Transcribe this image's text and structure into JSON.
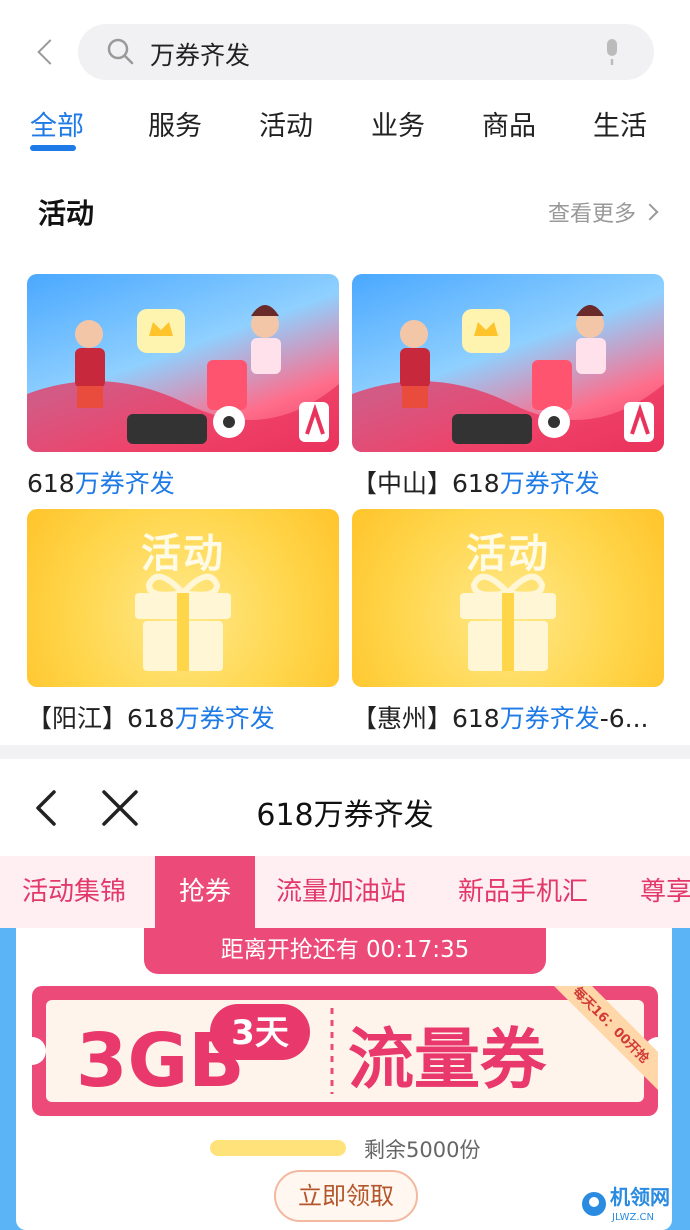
{
  "search": {
    "query": "万券齐发"
  },
  "tabs": [
    {
      "label": "全部",
      "active": true
    },
    {
      "label": "服务"
    },
    {
      "label": "活动"
    },
    {
      "label": "业务"
    },
    {
      "label": "商品"
    },
    {
      "label": "生活"
    }
  ],
  "section": {
    "title": "活动",
    "more": "查看更多"
  },
  "cards": [
    {
      "prefix": "618",
      "highlight": "万券齐发",
      "suffix": ""
    },
    {
      "prefix": "【中山】618",
      "highlight": "万券齐发",
      "suffix": ""
    },
    {
      "prefix": "【阳江】618",
      "highlight": "万券齐发",
      "suffix": "",
      "image_text": "活动"
    },
    {
      "prefix": "【惠州】618",
      "highlight": "万券齐发",
      "suffix": "-6...",
      "image_text": "活动"
    }
  ],
  "webview": {
    "title": "618万券齐发",
    "tabs": [
      "活动集锦",
      "抢券",
      "流量加油站",
      "新品手机汇",
      "尊享"
    ],
    "active_tab": "抢券",
    "countdown": "距离开抢还有 00:17:35",
    "coupon": {
      "amount": "3GB",
      "duration": "3天",
      "name": "流量券",
      "ribbon": "每天16：00开抢"
    },
    "remaining": "剩余5000份",
    "claim_button": "立即领取"
  },
  "watermark": {
    "text": "机领网",
    "sub": "JLWZ.CN"
  },
  "colors": {
    "accent_blue": "#1e7ae6",
    "accent_pink": "#ec4a78"
  }
}
